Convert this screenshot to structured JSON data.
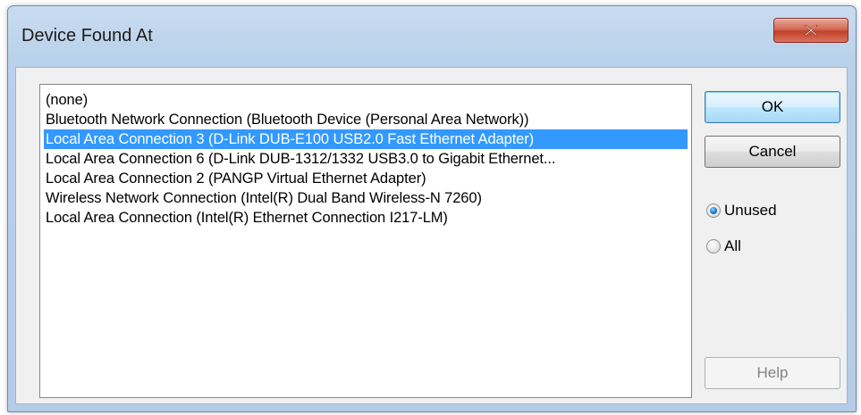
{
  "window": {
    "title": "Device Found At",
    "close_glyph": "x"
  },
  "list": {
    "items": [
      "(none)",
      "Bluetooth Network Connection (Bluetooth Device (Personal Area Network))",
      "Local Area Connection 3 (D-Link DUB-E100 USB2.0 Fast Ethernet Adapter)",
      "Local Area Connection 6 (D-Link DUB-1312/1332 USB3.0 to Gigabit Ethernet...",
      "Local Area Connection 2 (PANGP Virtual Ethernet Adapter)",
      "Wireless Network Connection (Intel(R) Dual Band Wireless-N 7260)",
      "Local Area Connection (Intel(R) Ethernet Connection I217-LM)"
    ],
    "selected_index": 2
  },
  "buttons": {
    "ok_label": "OK",
    "cancel_label": "Cancel",
    "help_label": "Help"
  },
  "filter": {
    "unused_label": "Unused",
    "all_label": "All",
    "selected": "Unused"
  },
  "colors": {
    "selection": "#3399ff",
    "close_button": "#c8452f"
  }
}
